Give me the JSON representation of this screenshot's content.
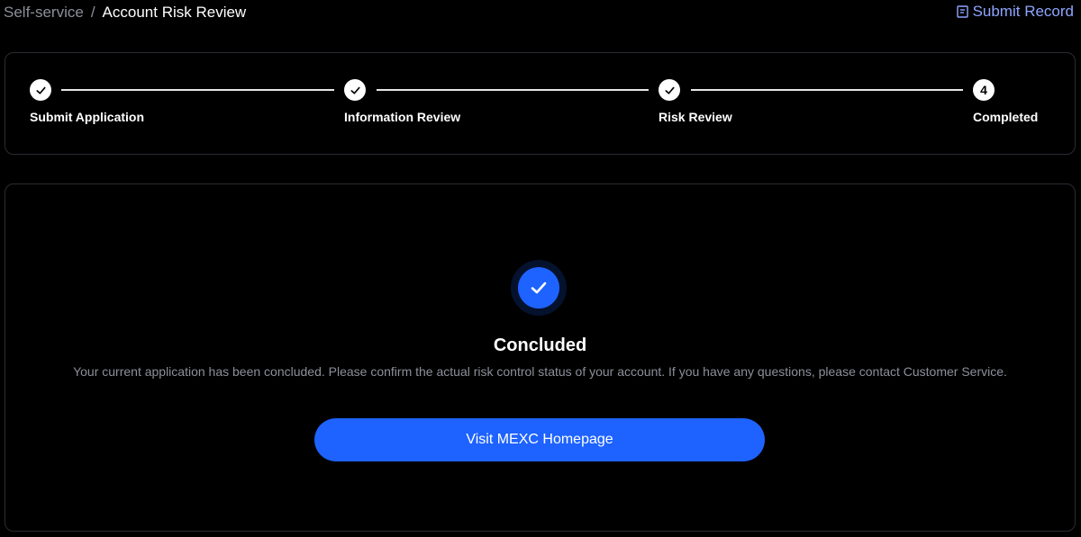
{
  "breadcrumb": {
    "parent": "Self-service",
    "separator": "/",
    "current": "Account Risk Review"
  },
  "header": {
    "submit_record_label": "Submit Record",
    "submit_record_icon": "document-icon",
    "link_color": "#8ea5ff"
  },
  "steps": [
    {
      "label": "Submit Application",
      "status": "done",
      "icon": "check-icon"
    },
    {
      "label": "Information Review",
      "status": "done",
      "icon": "check-icon"
    },
    {
      "label": "Risk Review",
      "status": "done",
      "icon": "check-icon"
    },
    {
      "label": "Completed",
      "status": "current",
      "number": "4"
    }
  ],
  "result": {
    "icon": "check-circle-icon",
    "title": "Concluded",
    "description": "Your current application has been concluded. Please confirm the actual risk control status of your account. If you have any questions, please contact Customer Service.",
    "button_label": "Visit MEXC Homepage",
    "accent_color": "#1e63ff"
  }
}
